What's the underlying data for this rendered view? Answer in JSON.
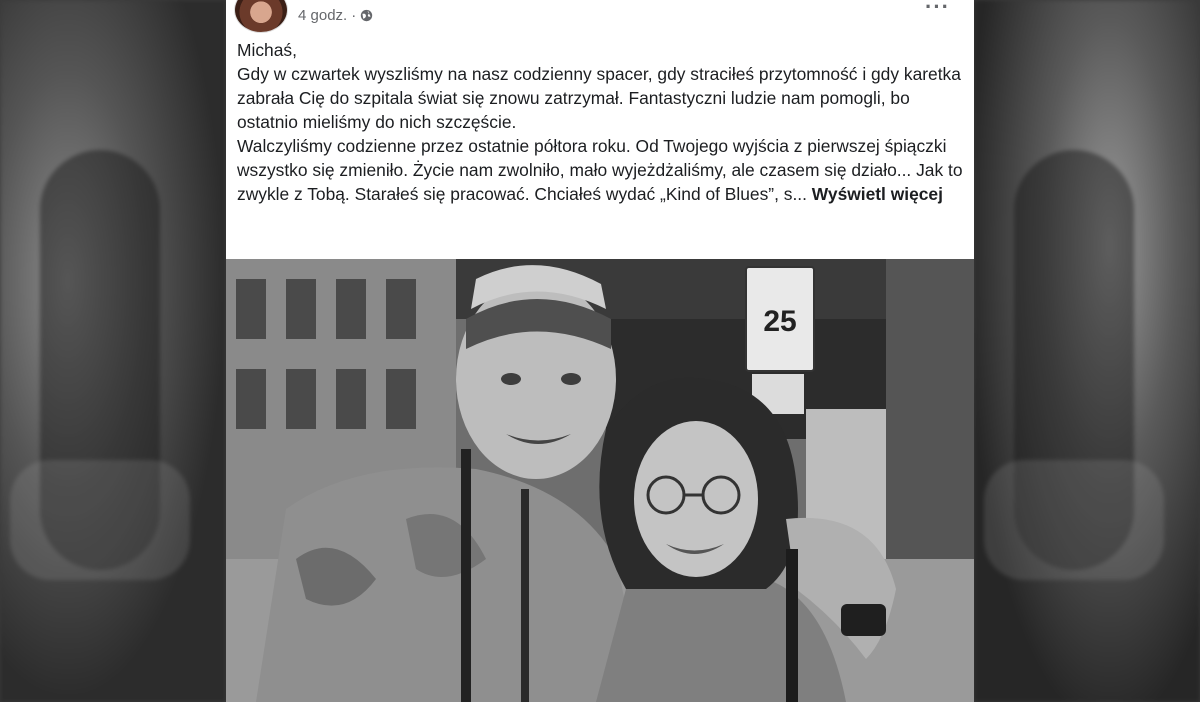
{
  "post": {
    "time": "4 godz.",
    "separator": "·",
    "audience_icon": "globe-icon",
    "more_icon": "more-options-icon",
    "text": {
      "greeting": "Michaś,",
      "line1": "Gdy w czwartek wyszliśmy na nasz codzienny spacer, gdy straciłeś przytomność i gdy karetka zabrała Cię do szpitala świat się znowu zatrzymał. Fantastyczni ludzie nam pomogli, bo ostatnio mieliśmy do nich szczęście.",
      "line2": "Walczyliśmy codzienne przez ostatnie półtora roku. Od Twojego wyjścia z pierwszej śpiączki wszystko się zmieniło. Życie nam zwolniło, mało wyjeżdżaliśmy, ale czasem się działo... Jak to zwykle z Tobą. Starałeś się pracować. Chciałeś wydać „Kind of Blues”, s...",
      "see_more": "Wyświetl więcej"
    },
    "photo": {
      "sign_number": "25"
    }
  }
}
